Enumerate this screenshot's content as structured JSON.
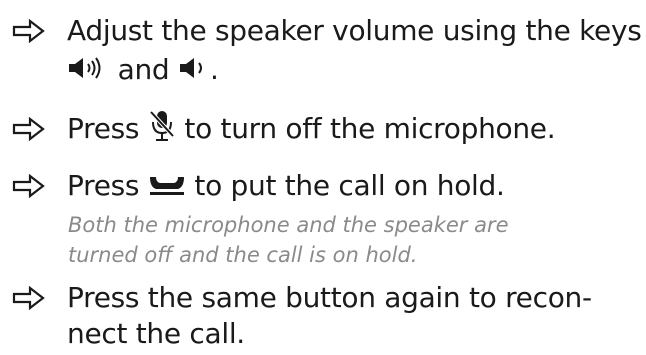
{
  "steps": [
    {
      "line1_before": "Adjust the speaker volume using the keys",
      "line2_and": "and",
      "line2_end": "."
    },
    {
      "before": "Press",
      "after": "to turn off the microphone."
    },
    {
      "before": "Press",
      "after": "to put the call on hold.",
      "note_line1": "Both the microphone and the speaker are",
      "note_line2": "turned off and the call is on hold."
    },
    {
      "line1": "Press the same button again to recon-",
      "line2": "nect the call."
    }
  ],
  "icons": {
    "bullet": "arrow-right-outline-icon",
    "volume_up": "speaker-volume-up-icon",
    "volume_down": "speaker-volume-down-icon",
    "mic_off": "microphone-off-icon",
    "hold": "call-hold-handset-icon"
  },
  "colors": {
    "text": "#1a1a1a",
    "note": "#8a8a8a"
  }
}
